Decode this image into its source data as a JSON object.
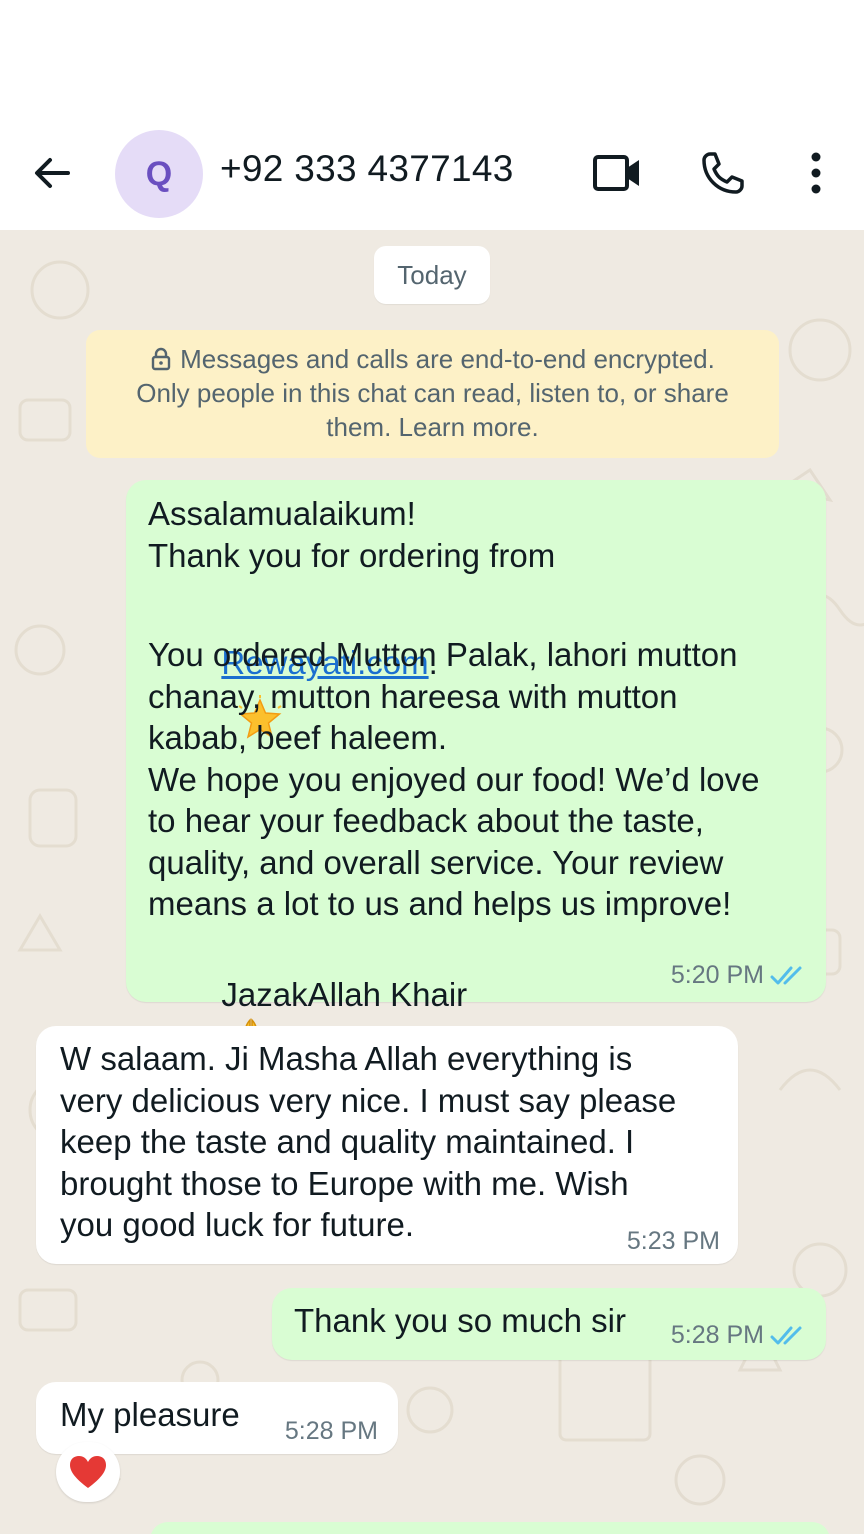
{
  "app": {
    "contact_initial": "Q",
    "contact_name": "+92 333 4377143"
  },
  "icons": {
    "back": "arrow-left-icon",
    "video": "video-call-icon",
    "call": "phone-icon",
    "more": "more-vertical-icon",
    "lock": "lock-icon",
    "read": "double-check-icon"
  },
  "colors": {
    "outgoing_bubble": "#d9fdd3",
    "incoming_bubble": "#ffffff",
    "chat_background": "#efeae2",
    "notice_background": "#fdf1c7",
    "read_ticks": "#53bdeb",
    "avatar_background": "#e5dcf7"
  },
  "chat": {
    "date_chip": "Today",
    "encryption_notice": {
      "line1": "Messages and calls are end-to-end encrypted.",
      "line2": "Only people in this chat can read, listen to, or share",
      "line3": "them. Learn more."
    },
    "messages": [
      {
        "direction": "out",
        "line1": "Assalamualaikum!",
        "line2": "Thank you for ordering from",
        "link": "Rewayati.com",
        "link_suffix": ".",
        "body": "You ordered Mutton Palak, lahori mutton\nchanay, mutton hareesa with mutton\nkabab, beef haleem.\nWe hope you enjoyed our food! We’d love\nto hear your feedback about the taste,\nquality, and overall service. Your review\nmeans a lot to us and helps us improve!",
        "signoff": "JazakAllah Khair",
        "time": "5:20 PM",
        "status": "read"
      },
      {
        "direction": "in",
        "text": "W salaam. Ji Masha Allah everything is\nvery delicious very nice. I must say please\nkeep the taste and quality maintained. I\nbrought those to Europe with me. Wish\nyou good luck for future.",
        "time": "5:23 PM"
      },
      {
        "direction": "out",
        "text": "Thank you so much sir",
        "time": "5:28 PM",
        "status": "read"
      },
      {
        "direction": "in",
        "text": "My pleasure",
        "time": "5:28 PM",
        "reaction": "red-heart"
      }
    ]
  }
}
